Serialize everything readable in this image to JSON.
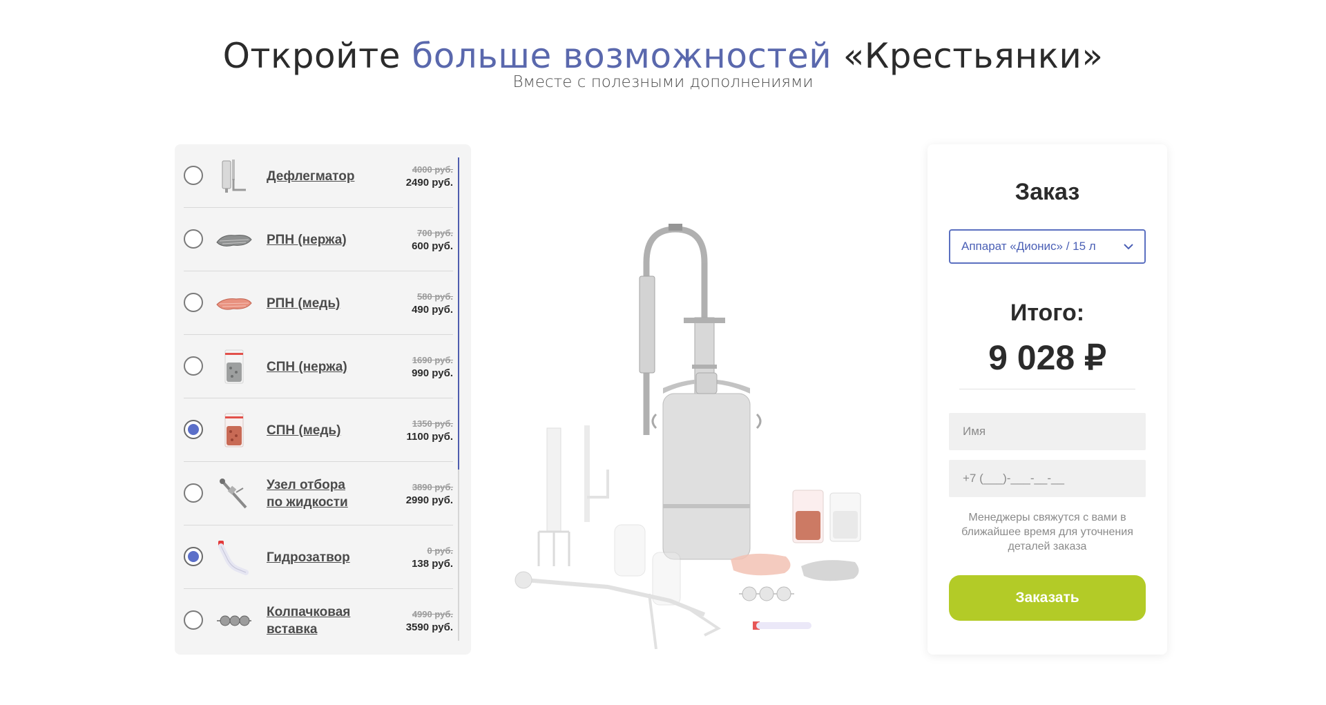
{
  "header": {
    "title_part1": "Откройте ",
    "title_accent": "больше возможностей",
    "title_part2": " «Крестьянки»",
    "subtitle": "Вместе с полезными дополнениями"
  },
  "addons": [
    {
      "name": "Дефлегматор",
      "old_price": "4000 руб.",
      "new_price": "2490 руб.",
      "selected": false,
      "icon": "dephlegmator-icon"
    },
    {
      "name": "РПН (нержа)",
      "old_price": "700 руб.",
      "new_price": "600 руб.",
      "selected": false,
      "icon": "steel-mesh-icon"
    },
    {
      "name": "РПН (медь)",
      "old_price": "580 руб.",
      "new_price": "490 руб.",
      "selected": false,
      "icon": "copper-mesh-icon"
    },
    {
      "name": "СПН (нержа)",
      "old_price": "1690 руб.",
      "new_price": "990 руб.",
      "selected": false,
      "icon": "steel-packing-bag-icon"
    },
    {
      "name": "СПН (медь)",
      "old_price": "1350 руб.",
      "new_price": "1100 руб.",
      "selected": true,
      "icon": "copper-packing-bag-icon"
    },
    {
      "name": "Узел отбора\nпо жидкости",
      "old_price": "3890 руб.",
      "new_price": "2990 руб.",
      "selected": false,
      "icon": "liquid-take-off-icon"
    },
    {
      "name": "Гидрозатвор",
      "old_price": "0 руб.",
      "new_price": "138 руб.",
      "selected": true,
      "icon": "water-seal-icon"
    },
    {
      "name": "Колпачковая\nвставка",
      "old_price": "4990 руб.",
      "new_price": "3590 руб.",
      "selected": false,
      "icon": "bubble-cap-insert-icon"
    }
  ],
  "order": {
    "title": "Заказ",
    "selected_product": "Аппарат «Дионис» / 15 л",
    "total_label": "Итого:",
    "total_value": "9 028 ₽",
    "name_placeholder": "Имя",
    "phone_placeholder": "+7 (___)-___-__-__",
    "note": "Менеджеры свяжутся с вами в ближайшее время для уточнения деталей заказа",
    "button_label": "Заказать"
  },
  "colors": {
    "accent": "#5a68ad",
    "button": "#b3cb27",
    "radio_checked": "#5b6fc9"
  }
}
